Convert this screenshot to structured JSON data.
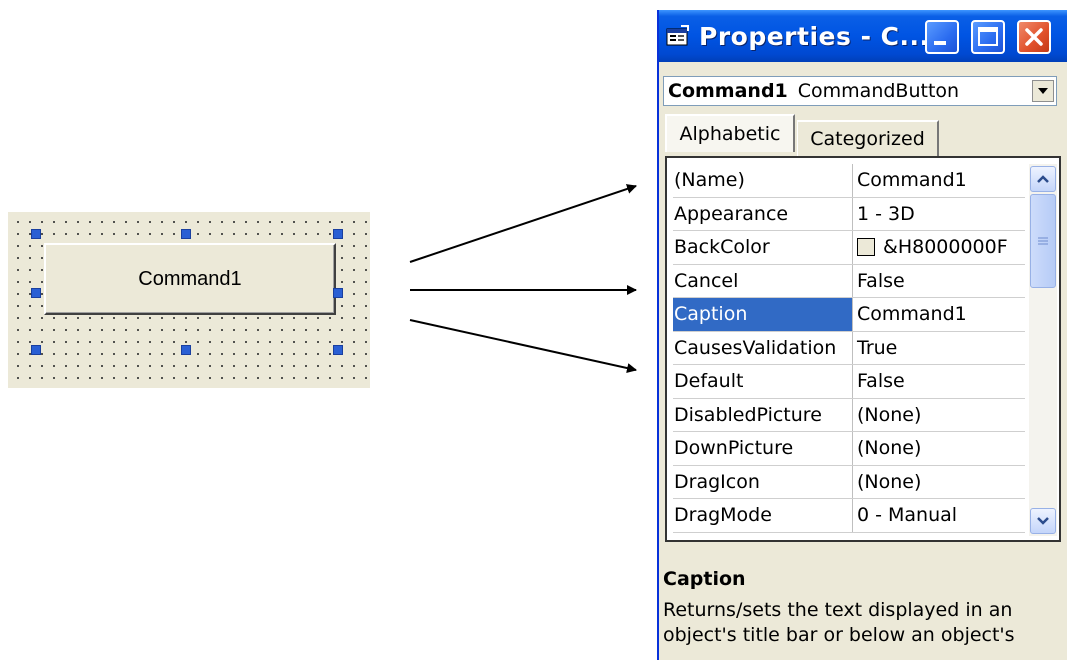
{
  "form_designer": {
    "command_button_caption": "Command1"
  },
  "properties_window": {
    "title": "Properties - C...",
    "object_selector": {
      "name": "Command1",
      "type": "CommandButton"
    },
    "tabs": [
      {
        "label": "Alphabetic",
        "active": true
      },
      {
        "label": "Categorized",
        "active": false
      }
    ],
    "properties": [
      {
        "name": "(Name)",
        "value": "Command1"
      },
      {
        "name": "Appearance",
        "value": "1 - 3D"
      },
      {
        "name": "BackColor",
        "value": "&H8000000F"
      },
      {
        "name": "Cancel",
        "value": "False"
      },
      {
        "name": "Caption",
        "value": "Command1",
        "selected": true
      },
      {
        "name": "CausesValidation",
        "value": "True"
      },
      {
        "name": "Default",
        "value": "False"
      },
      {
        "name": "DisabledPicture",
        "value": "(None)"
      },
      {
        "name": "DownPicture",
        "value": "(None)"
      },
      {
        "name": "DragIcon",
        "value": "(None)"
      },
      {
        "name": "DragMode",
        "value": "0 - Manual"
      }
    ],
    "description": {
      "title": "Caption",
      "text": "Returns/sets the text displayed in an object's title bar or below an object's"
    }
  },
  "icons": {
    "window_icon": "properties-window-icon",
    "minimize": "minimize-icon",
    "maximize": "maximize-icon",
    "close": "close-icon",
    "dropdown": "chevron-down-icon",
    "scroll_up": "scroll-up-icon",
    "scroll_down": "scroll-down-icon"
  },
  "colors": {
    "titlebar": "#0054e3",
    "selection": "#316ac5",
    "close_button": "#e0502a",
    "handle": "#2a5fd4"
  }
}
